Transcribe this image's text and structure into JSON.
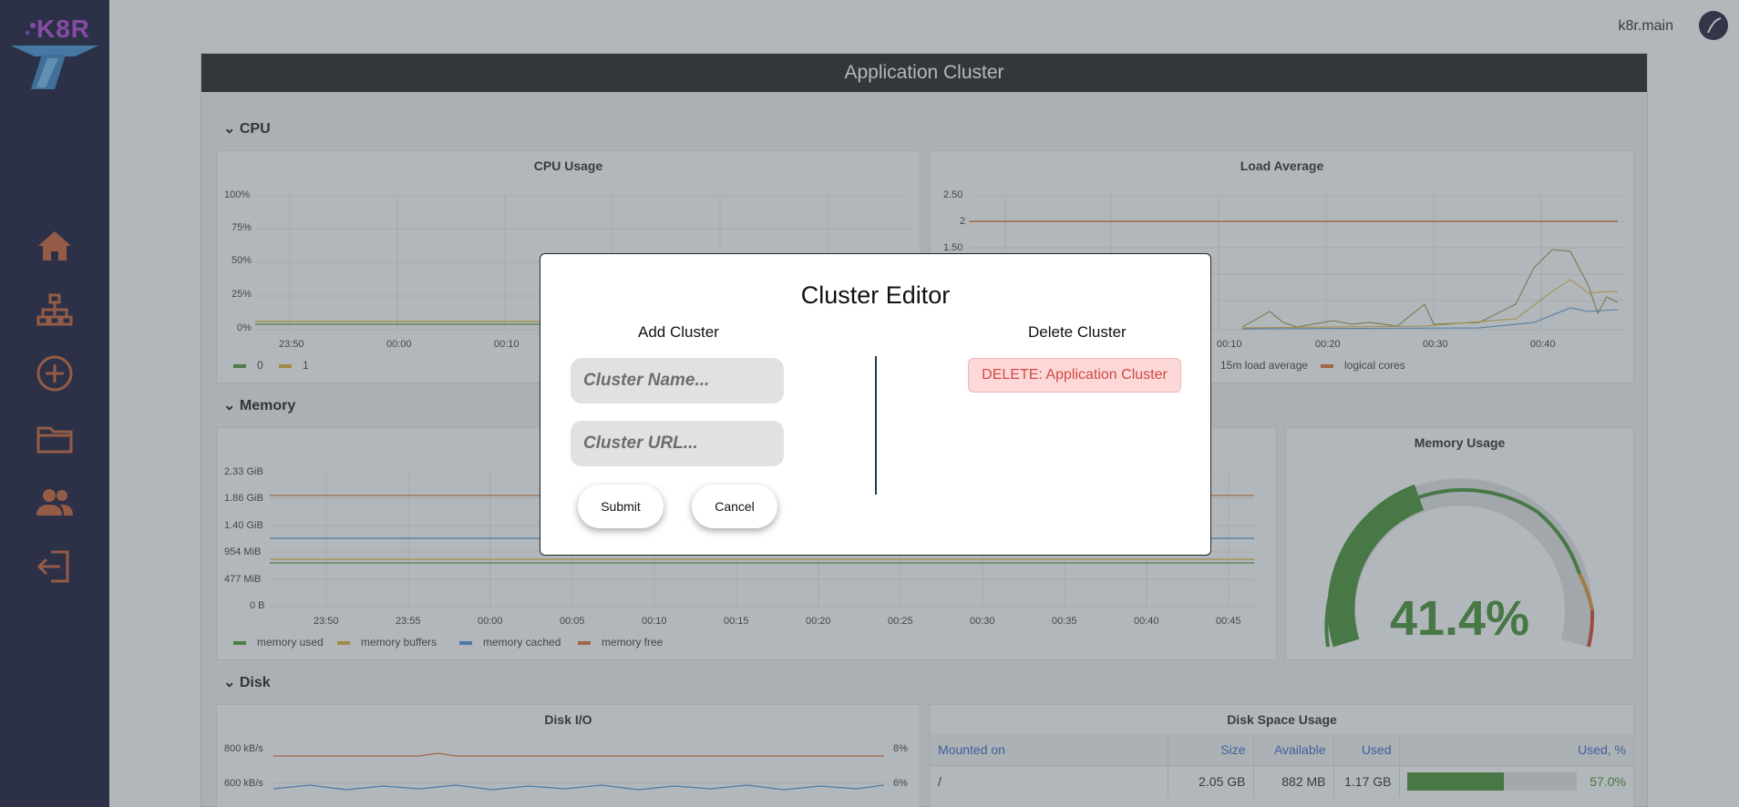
{
  "brand": {
    "logo_text": "K8R"
  },
  "user": {
    "name": "k8r.main"
  },
  "sidebar": {
    "items": [
      {
        "icon": "home-icon"
      },
      {
        "icon": "cluster-tree-icon"
      },
      {
        "icon": "add-circle-icon"
      },
      {
        "icon": "folder-icon"
      },
      {
        "icon": "users-icon"
      },
      {
        "icon": "logout-icon"
      }
    ],
    "accent": "#c85a2a"
  },
  "panel": {
    "title": "Application Cluster"
  },
  "sections": {
    "cpu": "CPU",
    "memory": "Memory",
    "disk": "Disk",
    "caret": "⌄"
  },
  "cpu_usage": {
    "title": "CPU Usage",
    "y_ticks": [
      "100%",
      "75%",
      "50%",
      "25%",
      "0%"
    ],
    "x_ticks": [
      "23:50",
      "00:00",
      "00:10"
    ],
    "legend": [
      "0",
      "1"
    ]
  },
  "load_average": {
    "title": "Load Average",
    "y_ticks": [
      "2.50",
      "2",
      "1.50"
    ],
    "x_ticks": [
      "00:10",
      "00:20",
      "00:30",
      "00:40"
    ],
    "legend": [
      "15m load average",
      "logical cores"
    ]
  },
  "memory_chart": {
    "y_ticks": [
      "2.33 GiB",
      "1.86 GiB",
      "1.40 GiB",
      "954 MiB",
      "477 MiB",
      "0 B"
    ],
    "x_ticks": [
      "23:50",
      "23:55",
      "00:00",
      "00:05",
      "00:10",
      "00:15",
      "00:20",
      "00:25",
      "00:30",
      "00:35",
      "00:40",
      "00:45"
    ],
    "legend": [
      "memory used",
      "memory buffers",
      "memory cached",
      "memory free"
    ]
  },
  "memory_usage": {
    "title": "Memory Usage",
    "value_text": "41.4%",
    "value": 0.414
  },
  "disk_io": {
    "title": "Disk I/O",
    "y_ticks_left": [
      "800 kB/s",
      "600 kB/s"
    ],
    "y_ticks_right": [
      "8%",
      "6%"
    ]
  },
  "disk_space": {
    "title": "Disk Space Usage",
    "columns": [
      "Mounted on",
      "Size",
      "Available",
      "Used",
      "Used, %"
    ],
    "rows": [
      {
        "mount": "/",
        "size": "2.05 GB",
        "available": "882 MB",
        "used": "1.17 GB",
        "used_pct_text": "57.0%",
        "used_pct": 0.57
      }
    ]
  },
  "modal": {
    "title": "Cluster Editor",
    "add_title": "Add Cluster",
    "delete_title": "Delete Cluster",
    "name_placeholder": "Cluster Name...",
    "url_placeholder": "Cluster URL...",
    "submit_label": "Submit",
    "cancel_label": "Cancel",
    "delete_label": "DELETE: Application Cluster"
  },
  "colors": {
    "series_green": "#4a9a2f",
    "series_yellow": "#e0b12a",
    "series_blue": "#4a90d0",
    "series_orange": "#e0702a"
  }
}
